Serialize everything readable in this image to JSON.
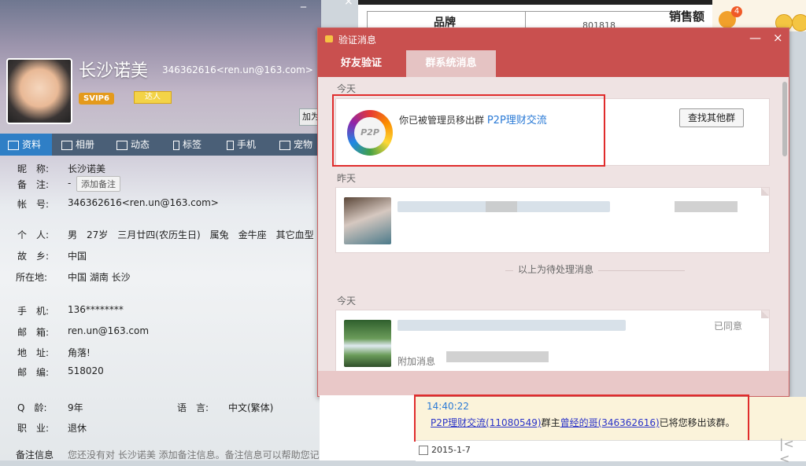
{
  "background_sheet": {
    "col1_header": "品牌",
    "col2_value": "801818",
    "col3_header": "销售额"
  },
  "tray": {
    "badge_count": "4"
  },
  "profile": {
    "window_controls": {
      "min": "_",
      "close": "×"
    },
    "nickname": "长沙诺美",
    "account_header": "346362616<ren.un@163.com>",
    "badge_svip": "SVIP6",
    "badge_daren": "达人",
    "add_button": "加为",
    "tabs": [
      {
        "label": "资料"
      },
      {
        "label": "相册"
      },
      {
        "label": "动态"
      },
      {
        "label": "标签"
      },
      {
        "label": "手机"
      },
      {
        "label": "宠物"
      }
    ],
    "fields": {
      "nick_label": "昵　称:",
      "nick_value": "长沙诺美",
      "note_label": "备　注:",
      "note_value": "-",
      "add_note": "添加备注",
      "account_label": "帐　号:",
      "account_value": "346362616<ren.un@163.com>",
      "personal_label": "个　人:",
      "personal_value": "男　27岁　三月廿四(农历生日)　属兔　金牛座　其它血型",
      "hometown_label": "故　乡:",
      "hometown_value": "中国",
      "location_label": "所在地:",
      "location_value": "中国 湖南 长沙",
      "phone_label": "手　机:",
      "phone_value": "136********",
      "email_label": "邮　箱:",
      "email_value": "ren.un@163.com",
      "address_label": "地　址:",
      "address_value": "角落!",
      "zip_label": "邮　编:",
      "zip_value": "518020",
      "qage_label": "Q　龄:",
      "qage_value": "9年",
      "lang_label": "语　言:",
      "lang_value": "中文(繁体)",
      "job_label": "职　业:",
      "job_value": "退休",
      "remark_label": "备注信息",
      "remark_value": "您还没有对 长沙诺美 添加备注信息。备注信息可以帮助您记录"
    }
  },
  "dialog": {
    "title": "验证消息",
    "minimize": "—",
    "close": "×",
    "tabs": [
      {
        "label": "好友验证"
      },
      {
        "label": "群系统消息"
      }
    ],
    "sections": {
      "today": "今天",
      "yesterday": "昨天",
      "today2": "今天"
    },
    "removed_card": {
      "logo_text": "P2P",
      "message": "你已被管理员移出群",
      "group_name": "P2P理财交流",
      "button": "查找其他群"
    },
    "pending_divider": "以上为待处理消息",
    "agreed_card": {
      "status": "已同意",
      "extra_label": "附加消息"
    }
  },
  "notice": {
    "time": "14:40:22",
    "group_link": "P2P理财交流(11080549)",
    "middle": "群主",
    "owner_link": "曾经的哥(346362616)",
    "tail": "已将您移出该群。"
  },
  "datebar": {
    "date": "2015-1-7",
    "nav": "|<  <"
  }
}
